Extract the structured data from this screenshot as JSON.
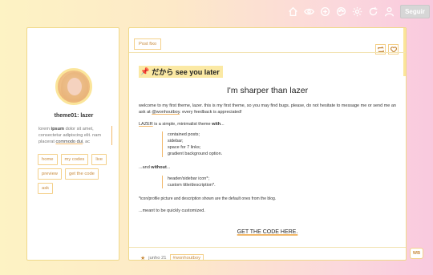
{
  "topbar": {
    "icons": [
      "home-icon",
      "eye-icon",
      "plus-circle-icon",
      "palette-icon",
      "settings-icon",
      "refresh-icon",
      "user-icon"
    ],
    "follow_label": "Seguir"
  },
  "sidebar": {
    "title": "theme01: lazer",
    "desc_part1": "lorem ",
    "desc_bold": "ipsum",
    "desc_part2": " dolor sit amet, consectetur adipiscing elit. nam placerat ",
    "desc_link": "commodo dui",
    "desc_part3": ", ac",
    "links": [
      "home",
      "my codes",
      "live",
      "preview",
      "get the code",
      "ask"
    ]
  },
  "post": {
    "fixed_tag": "Post fixo",
    "heading_pin": "📌",
    "heading": "だから see you later",
    "subtitle": "I'm sharper than lazer",
    "welcome_text": "welcome to my first theme, lazer. this is my first theme, so you may find bugs. please, do not hesitate to message me or send me an ask at ",
    "welcome_handle": "@wonhoutboy",
    "welcome_end": ". every feedback is appreciated!",
    "lazer_name": "LAZER",
    "lazer_text": " is a simple, minimalist theme ",
    "lazer_with": "with",
    "lazer_ellipsis": "...",
    "with_items": [
      "contained posts;",
      "sidebar;",
      "space for 7 links;",
      "gradient background option."
    ],
    "without_prefix": "...and ",
    "without_word": "without",
    "without_suffix": "...",
    "without_items": [
      "header/sidebar icon*;",
      "custom title/description*."
    ],
    "note": "*icon/profile picture and description shown are the default ones from the blog.",
    "meant": "...meant to be quickly customized.",
    "cta": "GET THE CODE HERE.",
    "footer_date": "junho 21",
    "footer_tag": "#wonhoutboy"
  },
  "badge": "WB",
  "colors": {
    "accent": "#f2b86a",
    "border": "#f0d98a",
    "highlight": "#fbe9a4",
    "gradient_left": "#fdf3c4",
    "gradient_right": "#f9c9de"
  }
}
